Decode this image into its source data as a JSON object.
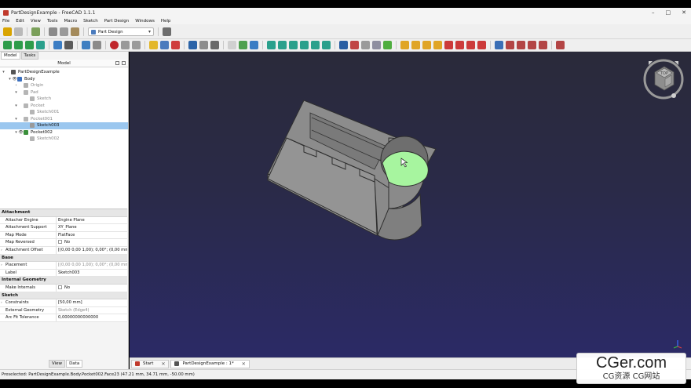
{
  "window": {
    "title": "PartDesignExample - FreeCAD 1.1.1",
    "controls": {
      "minimize": "–",
      "maximize": "□",
      "close": "✕"
    }
  },
  "menu": [
    "File",
    "Edit",
    "View",
    "Tools",
    "Macro",
    "Sketch",
    "Part Design",
    "Windows",
    "Help"
  ],
  "toolbar": {
    "workbench": "Part Design"
  },
  "left_tabs": {
    "model": "Model",
    "tasks": "Tasks"
  },
  "tree_header": "Model",
  "tree": [
    {
      "label": "PartDesignExample",
      "indent": 0,
      "arrow": "▾",
      "icon": "document-icon",
      "color": "#555555",
      "eye": "",
      "dim": false,
      "selected": false
    },
    {
      "label": "Body",
      "indent": 1,
      "arrow": "▾",
      "icon": "body-icon",
      "color": "#3a6fbf",
      "eye": "👁",
      "dim": false,
      "selected": false
    },
    {
      "label": "Origin",
      "indent": 2,
      "arrow": "›",
      "icon": "origin-icon",
      "color": "#b0b0b0",
      "eye": "",
      "dim": true,
      "selected": false
    },
    {
      "label": "Pad",
      "indent": 2,
      "arrow": "▾",
      "icon": "pad-icon",
      "color": "#b5b5b5",
      "eye": "",
      "dim": true,
      "selected": false
    },
    {
      "label": "Sketch",
      "indent": 3,
      "arrow": "",
      "icon": "sketch-icon",
      "color": "#b5b5b5",
      "eye": "",
      "dim": true,
      "selected": false
    },
    {
      "label": "Pocket",
      "indent": 2,
      "arrow": "▾",
      "icon": "pocket-icon",
      "color": "#b5b5b5",
      "eye": "",
      "dim": true,
      "selected": false
    },
    {
      "label": "Sketch001",
      "indent": 3,
      "arrow": "",
      "icon": "sketch-icon",
      "color": "#b5b5b5",
      "eye": "",
      "dim": true,
      "selected": false
    },
    {
      "label": "Pocket001",
      "indent": 2,
      "arrow": "▾",
      "icon": "pocket-icon",
      "color": "#b5b5b5",
      "eye": "",
      "dim": true,
      "selected": false
    },
    {
      "label": "Sketch003",
      "indent": 3,
      "arrow": "",
      "icon": "sketch-icon",
      "color": "#9a9a9a",
      "eye": "",
      "dim": false,
      "selected": true
    },
    {
      "label": "Pocket002",
      "indent": 2,
      "arrow": "▾",
      "icon": "pocket-icon",
      "color": "#3a8f3a",
      "eye": "👁",
      "dim": false,
      "selected": false
    },
    {
      "label": "Sketch002",
      "indent": 3,
      "arrow": "",
      "icon": "sketch-icon",
      "color": "#b5b5b5",
      "eye": "",
      "dim": true,
      "selected": false
    }
  ],
  "properties": [
    {
      "group": "Attachment",
      "rows": [
        {
          "name": "Attacher Engine",
          "value": "Engine Plane",
          "exp": "",
          "dim": false,
          "check": false
        },
        {
          "name": "Attachment Support",
          "value": "XY_Plane",
          "exp": "",
          "dim": false,
          "check": false
        },
        {
          "name": "Map Mode",
          "value": "FlatFace",
          "exp": "",
          "dim": false,
          "check": false
        },
        {
          "name": "Map Reversed",
          "value": "No",
          "exp": "",
          "dim": false,
          "check": true
        },
        {
          "name": "Attachment Offset",
          "value": "[(0,00 0,00 1,00); 0,00°; (0,00 mm ...",
          "exp": "›",
          "dim": false,
          "check": false
        }
      ]
    },
    {
      "group": "Base",
      "rows": [
        {
          "name": "Placement",
          "value": "[(0,00 0,00 1,00); 0,00°; (0,00 mm ...",
          "exp": "›",
          "dim": true,
          "check": false
        },
        {
          "name": "Label",
          "value": "Sketch003",
          "exp": "",
          "dim": false,
          "check": false
        }
      ]
    },
    {
      "group": "Internal Geometry",
      "rows": [
        {
          "name": "Make Internals",
          "value": "No",
          "exp": "",
          "dim": false,
          "check": true
        }
      ]
    },
    {
      "group": "Sketch",
      "rows": [
        {
          "name": "Constraints",
          "value": "[50,00 mm]",
          "exp": "›",
          "dim": false,
          "check": false
        },
        {
          "name": "External Geometry",
          "value": "Sketch (Edge4)",
          "exp": "",
          "dim": true,
          "check": false
        },
        {
          "name": "Arc Fit Tolerance",
          "value": "0,00000000000000",
          "exp": "",
          "dim": false,
          "check": false
        }
      ]
    }
  ],
  "bottom_tabs": {
    "view": "View",
    "data": "Data"
  },
  "doc_tabs": [
    {
      "label": "Start",
      "active": false
    },
    {
      "label": "PartDesignExample : 1*",
      "active": true
    }
  ],
  "navcube": {
    "face": "TOP"
  },
  "status": "Preselected: PartDesignExample.Body.Pocket002.Face23 (47.21 mm, 34.71 mm, -50.00 mm)",
  "watermark": {
    "line1": "CGer.com",
    "line2": "CG资源 CG网站"
  }
}
